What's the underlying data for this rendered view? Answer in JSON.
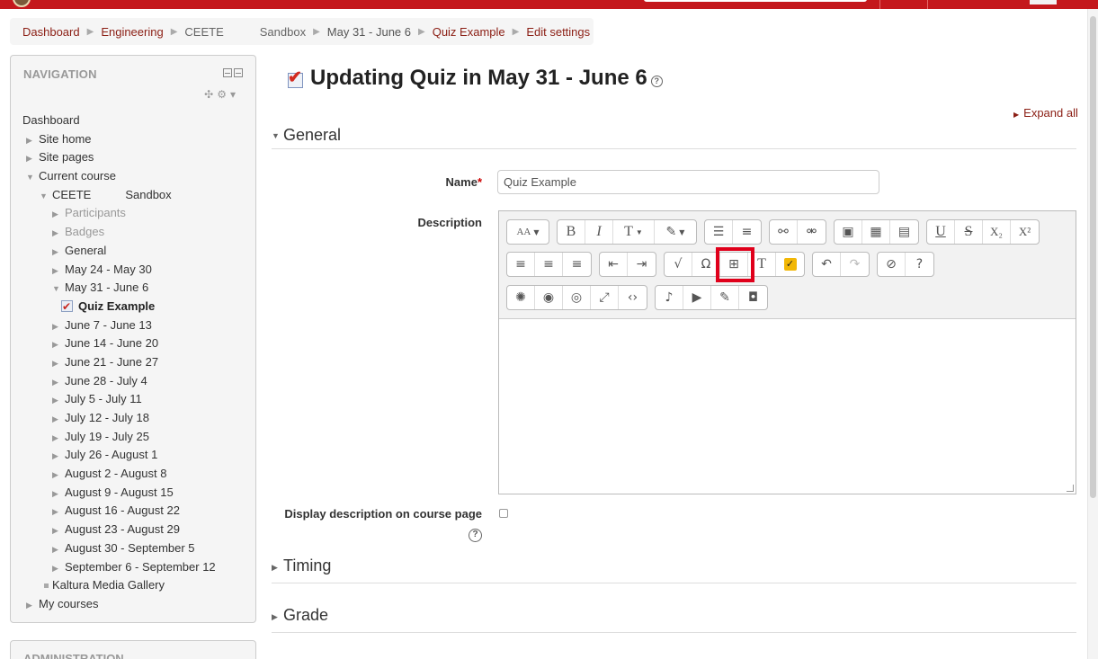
{
  "breadcrumb": {
    "items": [
      {
        "label": "Dashboard"
      },
      {
        "label": "Engineering"
      },
      {
        "label": "CEETE"
      },
      {
        "label": "Sandbox"
      },
      {
        "label": "May 31 - June 6"
      },
      {
        "label": "Quiz Example"
      },
      {
        "label": "Edit settings"
      }
    ]
  },
  "nav": {
    "title": "NAVIGATION",
    "tree": [
      {
        "label": "Dashboard"
      },
      {
        "label": "Site home"
      },
      {
        "label": "Site pages"
      },
      {
        "label": "Current course"
      },
      {
        "label": "CEETE",
        "label2": "Sandbox"
      },
      {
        "label": "Participants"
      },
      {
        "label": "Badges"
      },
      {
        "label": "General"
      },
      {
        "label": "May 24 - May 30"
      },
      {
        "label": "May 31 - June 6"
      },
      {
        "label": "Quiz Example"
      },
      {
        "label": "June 7 - June 13"
      },
      {
        "label": "June 14 - June 20"
      },
      {
        "label": "June 21 - June 27"
      },
      {
        "label": "June 28 - July 4"
      },
      {
        "label": "July 5 - July 11"
      },
      {
        "label": "July 12 - July 18"
      },
      {
        "label": "July 19 - July 25"
      },
      {
        "label": "July 26 - August 1"
      },
      {
        "label": "August 2 - August 8"
      },
      {
        "label": "August 9 - August 15"
      },
      {
        "label": "August 16 - August 22"
      },
      {
        "label": "August 23 - August 29"
      },
      {
        "label": "August 30 - September 5"
      },
      {
        "label": "September 6 - September 12"
      },
      {
        "label": "Kaltura Media Gallery"
      },
      {
        "label": "My courses"
      }
    ]
  },
  "admin": {
    "title": "ADMINISTRATION"
  },
  "page": {
    "title": "Updating Quiz in May 31 - June 6",
    "expand_all": "Expand all"
  },
  "sections": {
    "general": "General",
    "timing": "Timing",
    "grade": "Grade"
  },
  "form": {
    "name_label": "Name",
    "required_mark": "*",
    "name_value": "Quiz Example",
    "description_label": "Description",
    "display_desc_label": "Display description on course page"
  },
  "editor": {
    "icons": [
      "font-size-icon",
      "bold-icon",
      "italic-icon",
      "text-style-icon",
      "text-color-icon",
      "bullet-list-icon",
      "numbered-list-icon",
      "link-icon",
      "unlink-icon",
      "image-icon",
      "media-icon",
      "manage-files-icon",
      "underline-icon",
      "strikethrough-icon",
      "subscript-icon",
      "superscript-icon",
      "align-left-icon",
      "align-center-icon",
      "align-right-icon",
      "outdent-icon",
      "indent-icon",
      "equation-icon",
      "special-character-icon",
      "table-icon",
      "clear-formatting-icon",
      "kaltura-icon",
      "undo-icon",
      "redo-icon",
      "accessibility-checker-icon",
      "screenreader-helper-icon",
      "spellcheck-icon",
      "eye-icon",
      "preview-icon",
      "fullscreen-icon",
      "html-icon",
      "record-audio-icon",
      "record-video-icon",
      "draw-icon",
      "snapshot-icon"
    ]
  },
  "colors": {
    "brand_red": "#c4181c",
    "link": "#8b1e14",
    "highlight": "#e0001b"
  }
}
